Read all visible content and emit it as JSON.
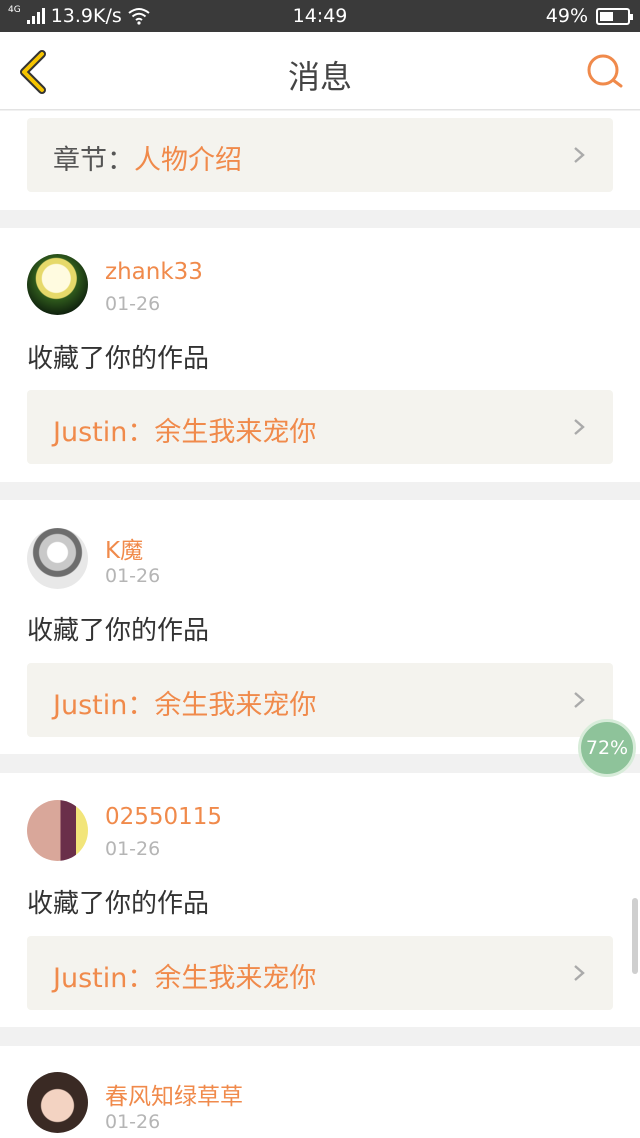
{
  "status_bar": {
    "network_type": "4G",
    "speed": "13.9K/s",
    "time": "14:49",
    "battery": "49%",
    "battery_level": 0.49
  },
  "header": {
    "title": "消息",
    "back_icon": "back-chevron-icon",
    "search_icon": "search-icon",
    "accent_color": "#f08a4b"
  },
  "top_link": {
    "label": "章节：",
    "value": "人物介绍"
  },
  "messages": [
    {
      "user": "zhank33",
      "date": "01-26",
      "action": "收藏了你的作品",
      "work": "Justin：余生我来宠你"
    },
    {
      "user": "K魔",
      "date": "01-26",
      "action": "收藏了你的作品",
      "work": "Justin：余生我来宠你"
    },
    {
      "user": "02550115",
      "date": "01-26",
      "action": "收藏了你的作品",
      "work": "Justin：余生我来宠你"
    },
    {
      "user": "春风知绿草草",
      "date": "01-26"
    }
  ],
  "floating_badge": {
    "text": "72%"
  }
}
